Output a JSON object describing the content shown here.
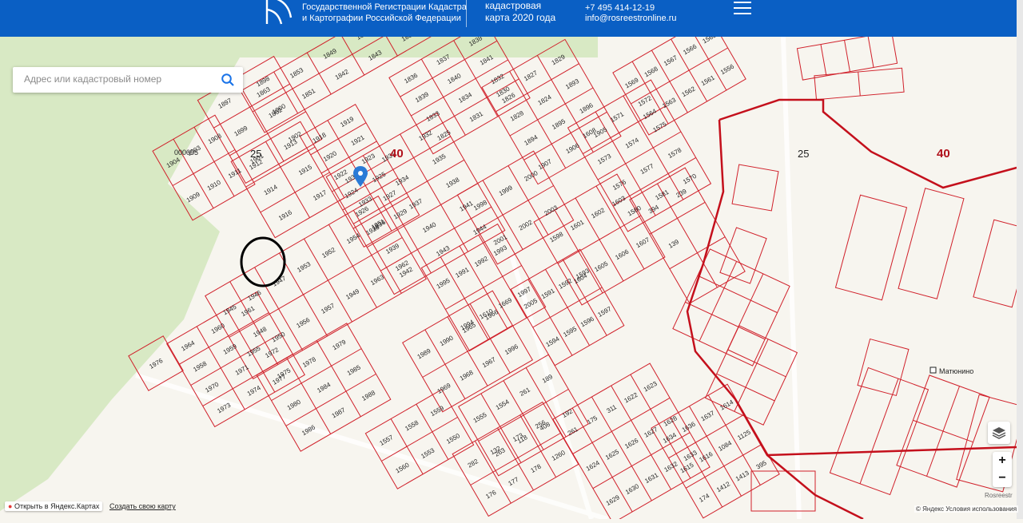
{
  "header": {
    "org_line1": "Государственной Регистрации Кадастра",
    "org_line2": "и Картографии Российской Федерации",
    "map_line1": "кадастровая",
    "map_line2": "карта 2020 года",
    "phone": "+7 495 414-12-19",
    "email": "info@rosreestronline.ru"
  },
  "search": {
    "placeholder": "Адрес или кадастровый номер"
  },
  "map": {
    "quarter_labels": [
      "40",
      "25",
      "40",
      "25"
    ],
    "village": "Матюнино",
    "parcel_code": "000005"
  },
  "parcels": [
    "1863",
    "1853",
    "1849",
    "1892",
    "1850",
    "1852",
    "1851",
    "1842",
    "1843",
    "1835",
    "1836",
    "1837",
    "1838",
    "1839",
    "1840",
    "1841",
    "1833",
    "1834",
    "1832",
    "1825",
    "1831",
    "1826",
    "1830",
    "1827",
    "1829",
    "1828",
    "1824",
    "1893",
    "1894",
    "1895",
    "1896",
    "1907",
    "1906",
    "1905",
    "1897",
    "1898",
    "1899",
    "1900",
    "1901",
    "1902",
    "1904",
    "1903",
    "1908",
    "1909",
    "1910",
    "1911",
    "1912",
    "1913",
    "1914",
    "1915",
    "1916",
    "1917",
    "1918",
    "1919",
    "1920",
    "1921",
    "1922",
    "1923",
    "1924",
    "1925",
    "1926",
    "1927",
    "1928",
    "1929",
    "1930",
    "1931",
    "1932",
    "1933",
    "1934",
    "1935",
    "1936",
    "1937",
    "1938",
    "1939",
    "1940",
    "1941",
    "1942",
    "1943",
    "1944",
    "1945",
    "1946",
    "1947",
    "1953",
    "1952",
    "1954",
    "1951",
    "1955",
    "1950",
    "1956",
    "1957",
    "1949",
    "1963",
    "1962",
    "1964",
    "1960",
    "1961",
    "1958",
    "1959",
    "1948",
    "1970",
    "1971",
    "1972",
    "1973",
    "1974",
    "1975",
    "1976",
    "1977",
    "1978",
    "1979",
    "1980",
    "1984",
    "1985",
    "1986",
    "1987",
    "1988",
    "1989",
    "1990",
    "1965",
    "1966",
    "1969",
    "1968",
    "1967",
    "1996",
    "1995",
    "1991",
    "1992",
    "1993",
    "1994",
    "1610",
    "1669",
    "1997",
    "1998",
    "1999",
    "2000",
    "2001",
    "2002",
    "2003",
    "2005",
    "1591",
    "1592",
    "1593",
    "1594",
    "1595",
    "1596",
    "1597",
    "1598",
    "1601",
    "1602",
    "1603",
    "1604",
    "1605",
    "1606",
    "1607",
    "1608",
    "1571",
    "1572",
    "1573",
    "1574",
    "1575",
    "1576",
    "1577",
    "1578",
    "1580",
    "1581",
    "1570",
    "1569",
    "1568",
    "1567",
    "1566",
    "1565",
    "1564",
    "1563",
    "1562",
    "1561",
    "1556",
    "1557",
    "1558",
    "1559",
    "1560",
    "1553",
    "1550",
    "1555",
    "1554",
    "261",
    "189",
    "263",
    "118",
    "408",
    "192",
    "282",
    "132",
    "173",
    "256",
    "176",
    "177",
    "178",
    "1260",
    "261",
    "175",
    "311",
    "1622",
    "1623",
    "1624",
    "1625",
    "1626",
    "1627",
    "1628",
    "1629",
    "1630",
    "1631",
    "1632",
    "1633",
    "1634",
    "1636",
    "1637",
    "1614",
    "1615",
    "1616",
    "1084",
    "1125",
    "174",
    "1412",
    "1413",
    "395",
    "394",
    "239",
    "139"
  ],
  "controls": {
    "zoom_in": "+",
    "zoom_out": "−"
  },
  "footer": {
    "open_yandex": "Открыть в Яндекс.Картах",
    "create_map": "Создать свою карту",
    "copyright": "© Яндекс Условия использования",
    "watermark": "Rosreestr"
  },
  "colors": {
    "header_bg": "#0a5fc4",
    "parcel_line": "#d0202a",
    "forest": "#d8e9c4",
    "marker": "#2a7ad6"
  }
}
